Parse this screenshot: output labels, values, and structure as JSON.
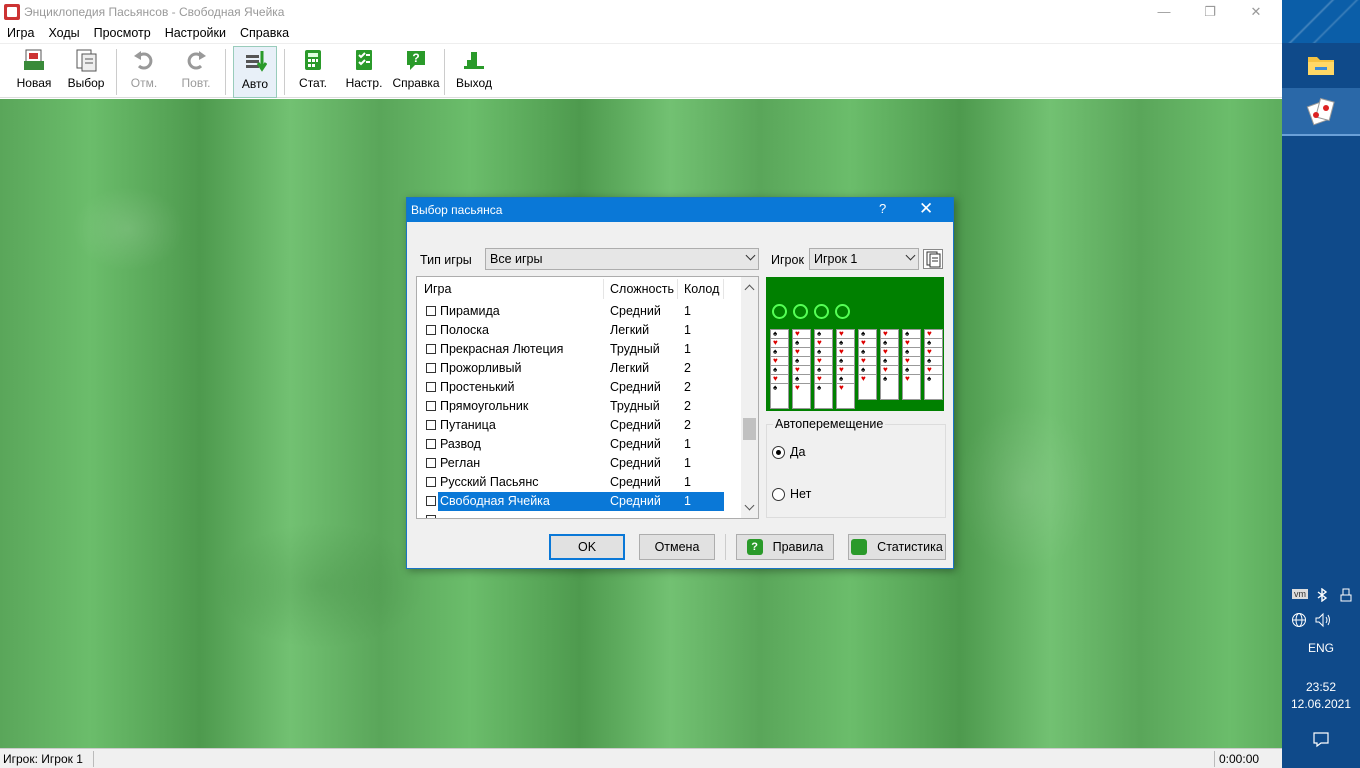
{
  "window": {
    "title": "Энциклопедия Пасьянсов  -  Свободная Ячейка",
    "minimize": "—",
    "restore": "❐",
    "close": "✕"
  },
  "menu": [
    "Игра",
    "Ходы",
    "Просмотр",
    "Настройки",
    "Справка"
  ],
  "toolbar": {
    "new": "Новая",
    "select": "Выбор",
    "undo": "Отм.",
    "redo": "Повт.",
    "auto": "Авто",
    "stats": "Стат.",
    "settings": "Настр.",
    "help": "Справка",
    "exit": "Выход"
  },
  "status": {
    "player": "Игрок: Игрок 1",
    "time": "0:00:00"
  },
  "dialog": {
    "title": "Выбор пасьянса",
    "help_glyph": "?",
    "close_glyph": "✕",
    "game_type_label": "Тип игры",
    "game_type_value": "Все игры",
    "player_label": "Игрок",
    "player_value": "Игрок 1",
    "columns": {
      "game": "Игра",
      "difficulty": "Сложность",
      "decks": "Колод"
    },
    "rows": [
      {
        "name": "Пирамида",
        "difficulty": "Средний",
        "decks": "1"
      },
      {
        "name": "Полоска",
        "difficulty": "Легкий",
        "decks": "1"
      },
      {
        "name": "Прекрасная Лютеция",
        "difficulty": "Трудный",
        "decks": "1"
      },
      {
        "name": "Прожорливый",
        "difficulty": "Легкий",
        "decks": "2"
      },
      {
        "name": "Простенький",
        "difficulty": "Средний",
        "decks": "2"
      },
      {
        "name": "Прямоугольник",
        "difficulty": "Трудный",
        "decks": "2"
      },
      {
        "name": "Путаница",
        "difficulty": "Средний",
        "decks": "2"
      },
      {
        "name": "Развод",
        "difficulty": "Средний",
        "decks": "1"
      },
      {
        "name": "Реглан",
        "difficulty": "Средний",
        "decks": "1"
      },
      {
        "name": "Русский Пасьянс",
        "difficulty": "Средний",
        "decks": "1"
      },
      {
        "name": "Свободная Ячейка",
        "difficulty": "Средний",
        "decks": "1"
      }
    ],
    "selected_row": 10,
    "autoplace": {
      "legend": "Автоперемещение",
      "yes": "Да",
      "no": "Нет",
      "selected": "yes"
    },
    "buttons": {
      "ok": "OK",
      "cancel": "Отмена",
      "rules": "Правила",
      "statistics": "Статистика"
    }
  },
  "taskbar": {
    "language": "ENG",
    "time": "23:52",
    "date": "12.06.2021",
    "vm_badge": "vm"
  },
  "colors": {
    "accent": "#0a78d7",
    "felt": "#60ae60",
    "preview_felt": "#008000",
    "taskbar": "#0f4a8a"
  }
}
